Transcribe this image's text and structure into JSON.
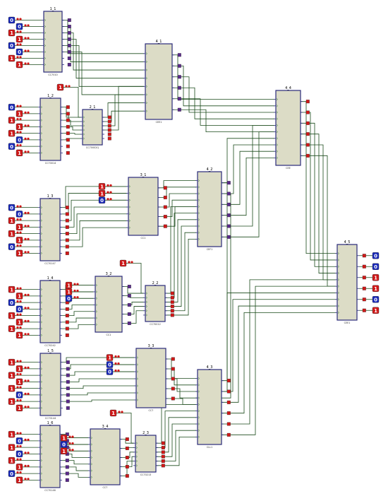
{
  "colors": {
    "chip_fill": "#dcdcc6",
    "chip_border": "#2a2a7a",
    "wire": "#1a4a1a",
    "logic_high": "#d01818",
    "logic_low": "#1828b8",
    "pin_high": "#d01818",
    "pin_low": "#5a2a8a"
  },
  "chips": [
    {
      "id": "c1_1",
      "label": "1_1",
      "sub": "CC7010"
    },
    {
      "id": "c1_2",
      "label": "1_2",
      "sub": "CC70014"
    },
    {
      "id": "c2_1",
      "label": "2_1",
      "sub": "CC70002Q"
    },
    {
      "id": "c4_1",
      "label": "4_1",
      "sub": "CEE1"
    },
    {
      "id": "c4_4",
      "label": "4_4",
      "sub": "CEE"
    },
    {
      "id": "c3_1",
      "label": "3_1",
      "sub": "CC1"
    },
    {
      "id": "c4_2",
      "label": "4_2",
      "sub": "CEF1"
    },
    {
      "id": "c1_3",
      "label": "1_3",
      "sub": "CC70147"
    },
    {
      "id": "c1_4",
      "label": "1_4",
      "sub": "CC70242"
    },
    {
      "id": "c3_2",
      "label": "3_2",
      "sub": "CC1"
    },
    {
      "id": "c2_2",
      "label": "2_2",
      "sub": "CC70012"
    },
    {
      "id": "c4_5",
      "label": "4_5",
      "sub": "CEE1"
    },
    {
      "id": "c1_5",
      "label": "1_5",
      "sub": "CC70144"
    },
    {
      "id": "c3_3",
      "label": "3_3",
      "sub": "CC7"
    },
    {
      "id": "c4_3",
      "label": "4_3",
      "sub": "CLL1"
    },
    {
      "id": "c1_6",
      "label": "1_6",
      "sub": "CC70146"
    },
    {
      "id": "c3_4",
      "label": "3_4",
      "sub": "CC7"
    },
    {
      "id": "c2_3",
      "label": "2_3",
      "sub": "CC70213"
    }
  ],
  "inputs": [
    {
      "chip": "c1_1",
      "values": [
        "0",
        "0",
        "1",
        "1",
        "0",
        "0",
        "1",
        "1"
      ]
    },
    {
      "chip": "c1_2",
      "values": [
        "0",
        "1",
        "1",
        "1",
        "1",
        "0",
        "0",
        "1"
      ]
    },
    {
      "chip": "c1_3",
      "values": [
        "0",
        "0",
        "1",
        "1",
        "1",
        "1",
        "0",
        "1"
      ]
    },
    {
      "chip": "c1_4",
      "values": [
        "1",
        "1",
        "0",
        "0",
        "1",
        "1",
        "1",
        "1"
      ]
    },
    {
      "chip": "c1_5",
      "values": [
        "1",
        "1",
        "1",
        "1",
        "1",
        "0",
        "1",
        "1"
      ]
    },
    {
      "chip": "c1_6",
      "values": [
        "1",
        "0",
        "1",
        "0",
        "1",
        "1",
        "0",
        "1"
      ]
    }
  ],
  "mode_inputs": [
    {
      "chip": "c3_1",
      "values": [
        "1",
        "1",
        "0"
      ]
    },
    {
      "chip": "c3_2",
      "values": [
        "1",
        "1",
        "0"
      ]
    },
    {
      "chip": "c3_3",
      "values": [
        "1",
        "0",
        "0"
      ]
    },
    {
      "chip": "c3_4",
      "values": [
        "1",
        "0",
        "1"
      ]
    }
  ],
  "not_inputs": [
    {
      "chip": "c2_1",
      "value": "1"
    },
    {
      "chip": "c2_2",
      "value": "1"
    },
    {
      "chip": "c2_3",
      "value": "1"
    }
  ],
  "outputs": {
    "chip": "c4_5",
    "values": [
      "0",
      "0",
      "1",
      "1",
      "0",
      "1"
    ]
  }
}
